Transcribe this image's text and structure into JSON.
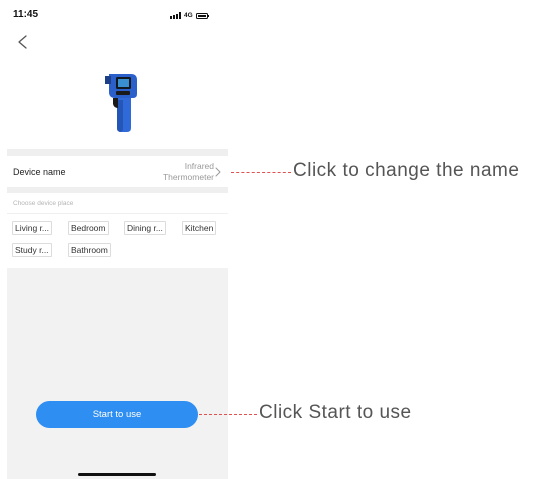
{
  "status_bar": {
    "time": "11:45",
    "network": "4G"
  },
  "device": {
    "name_label": "Device name",
    "name_value_line1": "Infrared",
    "name_value_line2": "Thermometer"
  },
  "places": {
    "caption": "Choose device place",
    "items": [
      "Living r...",
      "Bedroom",
      "Dining r...",
      "Kitchen",
      "Study r...",
      "Bathroom"
    ]
  },
  "start_button_label": "Start to use",
  "annotations": {
    "change_name": "Click to change the name",
    "start_to_use": "Click Start to use"
  },
  "colors": {
    "accent": "#2f8ef1",
    "annotation_line": "#e05050"
  }
}
